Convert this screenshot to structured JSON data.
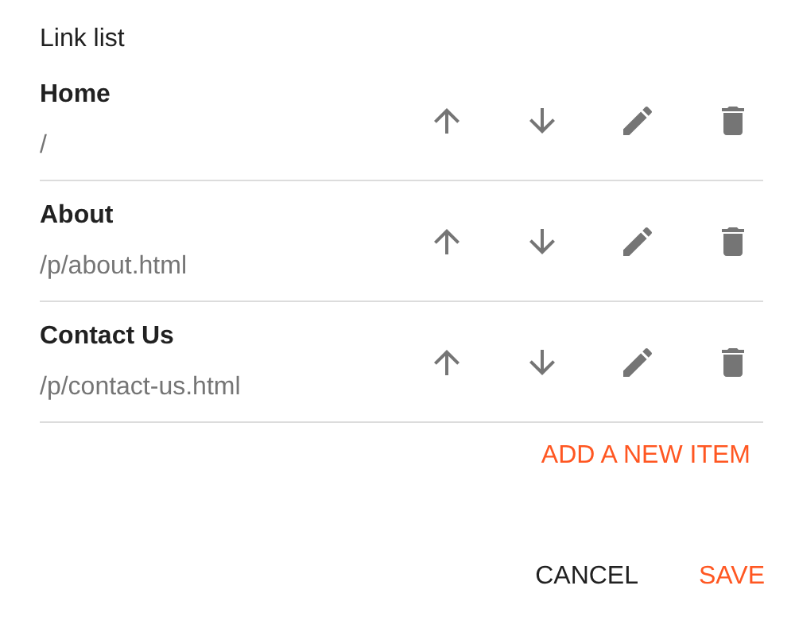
{
  "title": "Link list",
  "items": [
    {
      "title": "Home",
      "url": "/"
    },
    {
      "title": "About",
      "url": "/p/about.html"
    },
    {
      "title": "Contact Us",
      "url": "/p/contact-us.html"
    }
  ],
  "add_button": "ADD A NEW ITEM",
  "actions": [
    {
      "label": "CANCEL",
      "kind": "secondary"
    },
    {
      "label": "SAVE",
      "kind": "primary"
    }
  ]
}
